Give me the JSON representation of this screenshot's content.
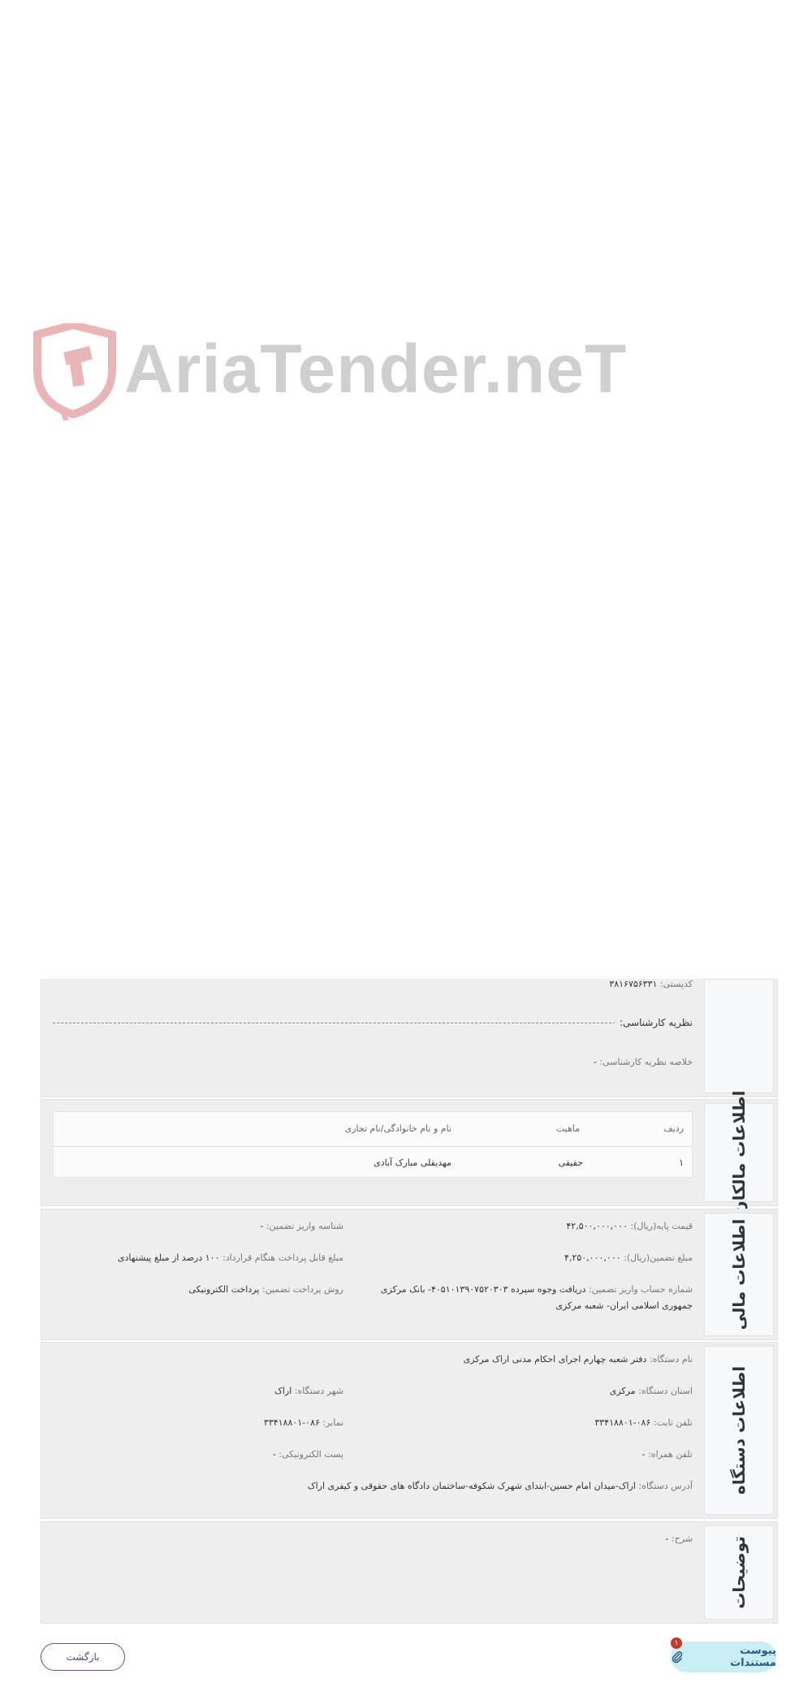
{
  "watermark": {
    "text": "AriaTender.neT"
  },
  "expert_section": {
    "postal_code_label": "کدپستی:",
    "postal_code_value": "۳۸۱۶۷۵۶۳۳۱",
    "expert_opinion_label": "نظریه کارشناسی:",
    "opinion_summary_label": "خلاصه نظریه کارشناسی:",
    "opinion_summary_value": "-"
  },
  "owners_section": {
    "title": "اطلاعات مالکان",
    "columns": [
      "ردیف",
      "ماهیت",
      "نام و نام خانوادگی/نام تجاری"
    ],
    "rows": [
      {
        "index": "۱",
        "type": "حقیقی",
        "name": "مهدیقلی مبارک آبادی"
      }
    ]
  },
  "financial_section": {
    "title": "اطلاعات مالی",
    "base_price_label": "قیمت پایه(ریال):",
    "base_price_value": "۴۲,۵۰۰,۰۰۰,۰۰۰",
    "deposit_id_label": "شناسه واریز تضمین:",
    "deposit_id_value": "-",
    "guarantee_amount_label": "مبلغ تضمین(ریال):",
    "guarantee_amount_value": "۴,۲۵۰,۰۰۰,۰۰۰",
    "payable_amount_label": "مبلغ قابل پرداخت هنگام قرارداد:",
    "payable_amount_value": "۱۰۰ درصد از مبلغ پیشنهادی",
    "account_label": "شماره حساب واریز تضمین:",
    "account_value_line1": "دریافت وجوه سپرده ۴۰۵۱۰۱۳۹۰۷۵۲۰۳۰۳- بانک مرکزی",
    "account_value_line2": "جمهوری اسلامی ایران- شعبه مرکزی",
    "payment_method_label": "روش پرداخت تضمین:",
    "payment_method_value": "پرداخت الکترونیکی"
  },
  "device_section": {
    "title": "اطلاعات دستگاه",
    "device_name_label": "نام دستگاه:",
    "device_name_value": "دفتر شعبه چهارم اجرای احکام مدنی اراک مرکزی",
    "province_label": "استان دستگاه:",
    "province_value": "مرکزی",
    "city_label": "شهر دستگاه:",
    "city_value": "اراک",
    "phone_label": "تلفن ثابت:",
    "phone_value": "۰۸۶-۳۳۴۱۸۸۰۱",
    "fax_label": "نمابر:",
    "fax_value": "۰۸۶-۳۳۴۱۸۸۰۱",
    "mobile_label": "تلفن همراه:",
    "mobile_value": "-",
    "email_label": "پست الکترونیکی:",
    "email_value": "-",
    "address_label": "آدرس دستگاه:",
    "address_value": "اراک-میدان امام حسین-ابتدای شهرک شکوفه-ساختمان دادگاه های حقوقی و کیفری اراک"
  },
  "description_section": {
    "title": "توضیحات",
    "desc_label": "شرح:",
    "desc_value": "-"
  },
  "actions": {
    "back_label": "بازگشت",
    "docs_label": "پیوست مستندات",
    "docs_badge": "۱",
    "docs_icon": "paperclip-icon"
  }
}
